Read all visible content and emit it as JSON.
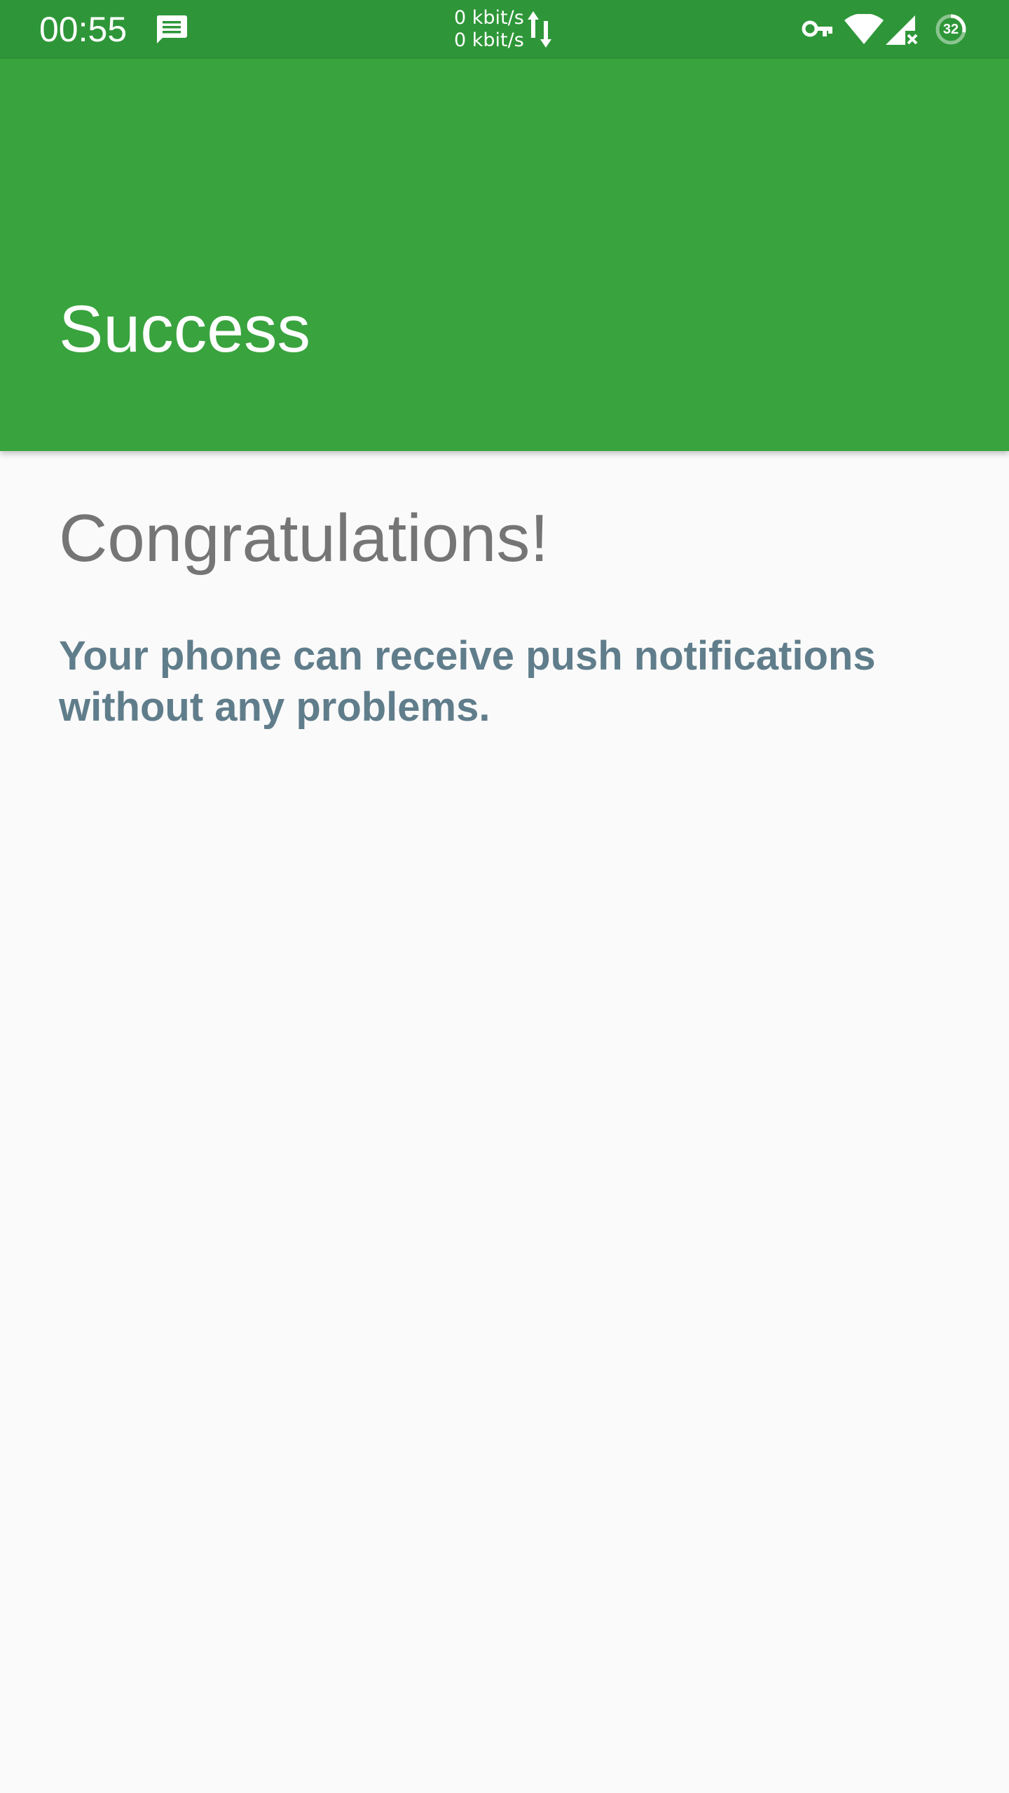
{
  "status_bar": {
    "time": "00:55",
    "notification_icon": "message-icon",
    "net_up": "0 kbit/s",
    "net_down": "0 kbit/s",
    "icons": [
      "vpn-key-icon",
      "wifi-icon",
      "signal-no-sim-icon",
      "battery-icon"
    ],
    "battery_level": "32",
    "bar_color": "#2e9638"
  },
  "app_bar": {
    "title": "Success",
    "color": "#39a33e"
  },
  "main": {
    "heading": "Congratulations!",
    "message": "Your phone can receive push notifications without any problems.",
    "heading_color": "#757575",
    "message_color": "#607d8b"
  }
}
